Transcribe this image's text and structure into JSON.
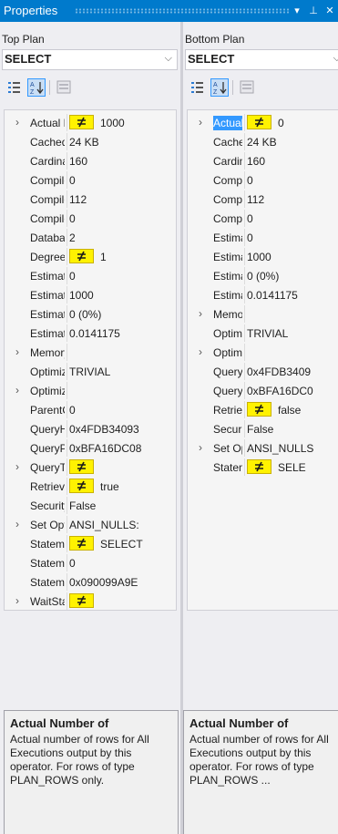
{
  "window": {
    "title": "Properties",
    "pin_glyph": "▾",
    "auto_hide_glyph": "⊥",
    "close_glyph": "✕"
  },
  "left": {
    "plan_label": "Top Plan",
    "operator": "SELECT",
    "rows": [
      {
        "exp": "›",
        "name": "Actual Number of Rows for All Executions",
        "value": "1000",
        "warn": true
      },
      {
        "exp": "",
        "name": "Cached plan size",
        "value": "24 KB"
      },
      {
        "exp": "",
        "name": "CardinalityEstimationModelVersion",
        "value": "160"
      },
      {
        "exp": "",
        "name": "CompileCPU",
        "value": "0"
      },
      {
        "exp": "",
        "name": "CompileMemory",
        "value": "112"
      },
      {
        "exp": "",
        "name": "CompileTime",
        "value": "0"
      },
      {
        "exp": "",
        "name": "DatabaseContextSettingsId",
        "value": "2"
      },
      {
        "exp": "",
        "name": "Degree of Parallelism",
        "value": "1",
        "warn": true
      },
      {
        "exp": "",
        "name": "Estimated Number of Rows",
        "value": "0"
      },
      {
        "exp": "",
        "name": "Estimated Number of Rows for All Executions",
        "value": "1000"
      },
      {
        "exp": "",
        "name": "Estimated Number of Rows Per Execution",
        "value": "0 (0%)"
      },
      {
        "exp": "",
        "name": "Estimated Subtree Cost",
        "value": "0.0141175"
      },
      {
        "exp": "›",
        "name": "Memory Grant Info",
        "value": "",
        "hasval": true
      },
      {
        "exp": "",
        "name": "Optimization Level",
        "value": "TRIVIAL"
      },
      {
        "exp": "›",
        "name": "OptimizerHardwareDependentProperties",
        "value": "",
        "hasval": true
      },
      {
        "exp": "",
        "name": "ParentObjectId",
        "value": "0"
      },
      {
        "exp": "",
        "name": "QueryHash",
        "value": "0x4FDB34093"
      },
      {
        "exp": "",
        "name": "QueryPlanHash",
        "value": "0xBFA16DC08"
      },
      {
        "exp": "›",
        "name": "QueryTimeStats",
        "value": "",
        "hasval": true,
        "warn": true
      },
      {
        "exp": "",
        "name": "RetrievedFromCache",
        "value": "true",
        "warn": true
      },
      {
        "exp": "",
        "name": "SecurityPolicyApplied",
        "value": "False"
      },
      {
        "exp": "›",
        "name": "Set Options",
        "value": "ANSI_NULLS:",
        "hasval": true
      },
      {
        "exp": "",
        "name": "Statement",
        "value": "SELECT",
        "warn": true,
        "hasval": true
      },
      {
        "exp": "",
        "name": "StatementId",
        "value": "0"
      },
      {
        "exp": "",
        "name": "StatementSubTreeCost",
        "value": "0x090099A9E"
      },
      {
        "exp": "›",
        "name": "WaitStats",
        "value": "",
        "hasval": true,
        "warn": true
      }
    ],
    "desc_title": "Actual Number of",
    "desc_text": "Actual number of rows for All Executions output by this operator. For rows of type PLAN_ROWS only."
  },
  "right": {
    "plan_label": "Bottom Plan",
    "operator": "SELECT",
    "rows": [
      {
        "exp": "›",
        "name": "Actual Number of Rows for All Executions",
        "value": "0",
        "warn": true,
        "selected": true
      },
      {
        "exp": "",
        "name": "Cached plan size",
        "value": "24 KB"
      },
      {
        "exp": "",
        "name": "CardinalityEstimationModelVersion",
        "value": "160"
      },
      {
        "exp": "",
        "name": "CompileCPU",
        "value": "0"
      },
      {
        "exp": "",
        "name": "CompileMemory",
        "value": "112"
      },
      {
        "exp": "",
        "name": "CompileTime",
        "value": "0"
      },
      {
        "exp": "",
        "name": "Estimated Number of Rows",
        "value": "0"
      },
      {
        "exp": "",
        "name": "Estimated Number of Rows for All Executions",
        "value": "1000"
      },
      {
        "exp": "",
        "name": "Estimated Number of Rows Per Execution",
        "value": "0 (0%)"
      },
      {
        "exp": "",
        "name": "Estimated Subtree Cost",
        "value": "0.0141175"
      },
      {
        "exp": "›",
        "name": "Memory Grant Info",
        "value": "",
        "hasval": true
      },
      {
        "exp": "",
        "name": "Optimization Level",
        "value": "TRIVIAL"
      },
      {
        "exp": "›",
        "name": "OptimizerHardwareDependentProperties",
        "value": "",
        "hasval": true
      },
      {
        "exp": "",
        "name": "QueryHash",
        "value": "0x4FDB3409"
      },
      {
        "exp": "",
        "name": "QueryPlanHash",
        "value": "0xBFA16DC0"
      },
      {
        "exp": "",
        "name": "RetrievedFromCache",
        "value": "false",
        "warn": true
      },
      {
        "exp": "",
        "name": "SecurityPolicyApplied",
        "value": "False"
      },
      {
        "exp": "›",
        "name": "Set Options",
        "value": "ANSI_NULLS",
        "hasval": true
      },
      {
        "exp": "",
        "name": "Statement",
        "value": "SELE",
        "warn": true,
        "hasval": true
      }
    ],
    "desc_title": "Actual Number of",
    "desc_text": "Actual number of rows for All Executions output by this operator. For rows of type PLAN_ROWS ..."
  }
}
